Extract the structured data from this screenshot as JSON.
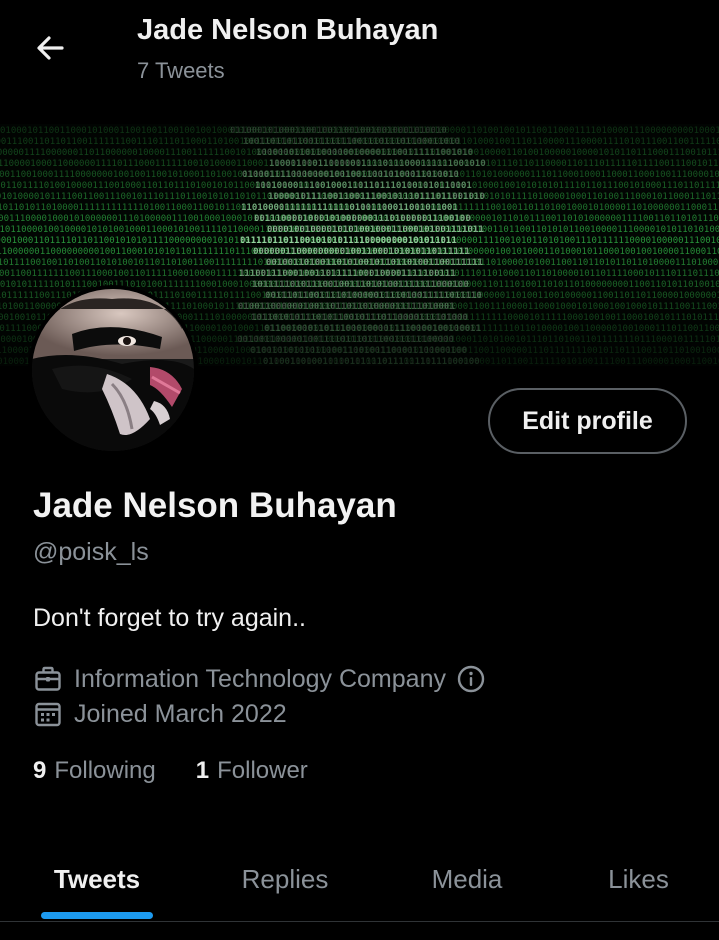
{
  "header": {
    "title": "Jade Nelson Buhayan",
    "subtitle": "7 Tweets",
    "back_icon": "arrow-left-icon"
  },
  "profile": {
    "edit_label": "Edit profile",
    "display_name": "Jade Nelson Buhayan",
    "handle": "@poisk_ls",
    "bio": "Don't forget to try again..",
    "category": "Information Technology Company",
    "joined": "Joined March 2022",
    "following_count": "9",
    "following_label": "Following",
    "followers_count": "1",
    "followers_label": "Follower"
  },
  "tabs": [
    {
      "label": "Tweets",
      "active": true
    },
    {
      "label": "Replies",
      "active": false
    },
    {
      "label": "Media",
      "active": false
    },
    {
      "label": "Likes",
      "active": false
    }
  ],
  "colors": {
    "background": "#000000",
    "accent": "#1d9bf0",
    "banner_code": "#39d353",
    "muted_text": "#8b9299"
  },
  "icons": {
    "category": "briefcase-icon",
    "joined": "calendar-icon",
    "category_info": "info-icon"
  }
}
